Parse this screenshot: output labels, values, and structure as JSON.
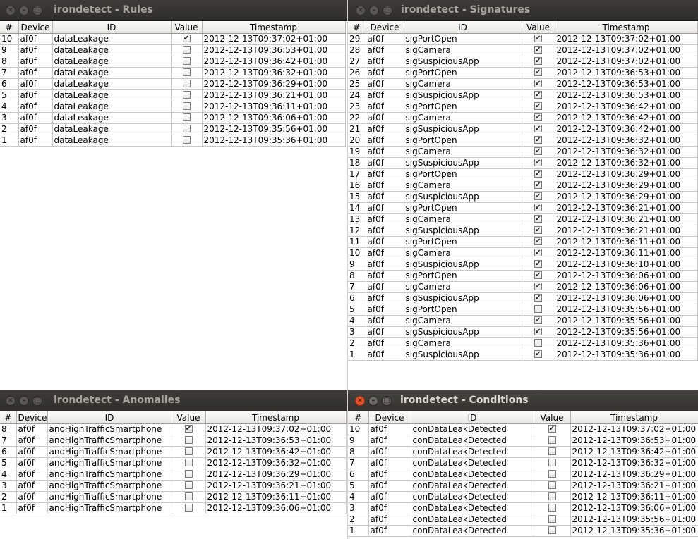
{
  "icons": {
    "close": "close-icon",
    "minimize": "minimize-icon",
    "maximize": "maximize-icon"
  },
  "colors": {
    "active_close": "#e5532c",
    "titlebar": "#3d3c38"
  },
  "windows": {
    "rules": {
      "title": "irondetect - Rules",
      "columns": [
        "#",
        "Device",
        "ID",
        "Value",
        "Timestamp"
      ],
      "rows": [
        {
          "n": "10",
          "device": "af0f",
          "id": "dataLeakage",
          "value": true,
          "ts": "2012-12-13T09:37:02+01:00"
        },
        {
          "n": "9",
          "device": "af0f",
          "id": "dataLeakage",
          "value": false,
          "ts": "2012-12-13T09:36:53+01:00"
        },
        {
          "n": "8",
          "device": "af0f",
          "id": "dataLeakage",
          "value": false,
          "ts": "2012-12-13T09:36:42+01:00"
        },
        {
          "n": "7",
          "device": "af0f",
          "id": "dataLeakage",
          "value": false,
          "ts": "2012-12-13T09:36:32+01:00"
        },
        {
          "n": "6",
          "device": "af0f",
          "id": "dataLeakage",
          "value": false,
          "ts": "2012-12-13T09:36:29+01:00"
        },
        {
          "n": "5",
          "device": "af0f",
          "id": "dataLeakage",
          "value": false,
          "ts": "2012-12-13T09:36:21+01:00"
        },
        {
          "n": "4",
          "device": "af0f",
          "id": "dataLeakage",
          "value": false,
          "ts": "2012-12-13T09:36:11+01:00"
        },
        {
          "n": "3",
          "device": "af0f",
          "id": "dataLeakage",
          "value": false,
          "ts": "2012-12-13T09:36:06+01:00"
        },
        {
          "n": "2",
          "device": "af0f",
          "id": "dataLeakage",
          "value": false,
          "ts": "2012-12-13T09:35:56+01:00"
        },
        {
          "n": "1",
          "device": "af0f",
          "id": "dataLeakage",
          "value": false,
          "ts": "2012-12-13T09:35:36+01:00"
        }
      ]
    },
    "signatures": {
      "title": "irondetect - Signatures",
      "columns": [
        "#",
        "Device",
        "ID",
        "Value",
        "Timestamp"
      ],
      "rows": [
        {
          "n": "29",
          "device": "af0f",
          "id": "sigPortOpen",
          "value": true,
          "ts": "2012-12-13T09:37:02+01:00"
        },
        {
          "n": "28",
          "device": "af0f",
          "id": "sigCamera",
          "value": true,
          "ts": "2012-12-13T09:37:02+01:00"
        },
        {
          "n": "27",
          "device": "af0f",
          "id": "sigSuspiciousApp",
          "value": true,
          "ts": "2012-12-13T09:37:02+01:00"
        },
        {
          "n": "26",
          "device": "af0f",
          "id": "sigPortOpen",
          "value": true,
          "ts": "2012-12-13T09:36:53+01:00"
        },
        {
          "n": "25",
          "device": "af0f",
          "id": "sigCamera",
          "value": true,
          "ts": "2012-12-13T09:36:53+01:00"
        },
        {
          "n": "24",
          "device": "af0f",
          "id": "sigSuspiciousApp",
          "value": true,
          "ts": "2012-12-13T09:36:53+01:00"
        },
        {
          "n": "23",
          "device": "af0f",
          "id": "sigPortOpen",
          "value": true,
          "ts": "2012-12-13T09:36:42+01:00"
        },
        {
          "n": "22",
          "device": "af0f",
          "id": "sigCamera",
          "value": true,
          "ts": "2012-12-13T09:36:42+01:00"
        },
        {
          "n": "21",
          "device": "af0f",
          "id": "sigSuspiciousApp",
          "value": true,
          "ts": "2012-12-13T09:36:42+01:00"
        },
        {
          "n": "20",
          "device": "af0f",
          "id": "sigPortOpen",
          "value": true,
          "ts": "2012-12-13T09:36:32+01:00"
        },
        {
          "n": "19",
          "device": "af0f",
          "id": "sigCamera",
          "value": true,
          "ts": "2012-12-13T09:36:32+01:00"
        },
        {
          "n": "18",
          "device": "af0f",
          "id": "sigSuspiciousApp",
          "value": true,
          "ts": "2012-12-13T09:36:32+01:00"
        },
        {
          "n": "17",
          "device": "af0f",
          "id": "sigPortOpen",
          "value": true,
          "ts": "2012-12-13T09:36:29+01:00"
        },
        {
          "n": "16",
          "device": "af0f",
          "id": "sigCamera",
          "value": true,
          "ts": "2012-12-13T09:36:29+01:00"
        },
        {
          "n": "15",
          "device": "af0f",
          "id": "sigSuspiciousApp",
          "value": true,
          "ts": "2012-12-13T09:36:29+01:00"
        },
        {
          "n": "14",
          "device": "af0f",
          "id": "sigPortOpen",
          "value": true,
          "ts": "2012-12-13T09:36:21+01:00"
        },
        {
          "n": "13",
          "device": "af0f",
          "id": "sigCamera",
          "value": true,
          "ts": "2012-12-13T09:36:21+01:00"
        },
        {
          "n": "12",
          "device": "af0f",
          "id": "sigSuspiciousApp",
          "value": true,
          "ts": "2012-12-13T09:36:21+01:00"
        },
        {
          "n": "11",
          "device": "af0f",
          "id": "sigPortOpen",
          "value": true,
          "ts": "2012-12-13T09:36:11+01:00"
        },
        {
          "n": "10",
          "device": "af0f",
          "id": "sigCamera",
          "value": true,
          "ts": "2012-12-13T09:36:11+01:00"
        },
        {
          "n": "9",
          "device": "af0f",
          "id": "sigSuspiciousApp",
          "value": true,
          "ts": "2012-12-13T09:36:10+01:00"
        },
        {
          "n": "8",
          "device": "af0f",
          "id": "sigPortOpen",
          "value": true,
          "ts": "2012-12-13T09:36:06+01:00"
        },
        {
          "n": "7",
          "device": "af0f",
          "id": "sigCamera",
          "value": true,
          "ts": "2012-12-13T09:36:06+01:00"
        },
        {
          "n": "6",
          "device": "af0f",
          "id": "sigSuspiciousApp",
          "value": true,
          "ts": "2012-12-13T09:36:06+01:00"
        },
        {
          "n": "5",
          "device": "af0f",
          "id": "sigPortOpen",
          "value": false,
          "ts": "2012-12-13T09:35:56+01:00"
        },
        {
          "n": "4",
          "device": "af0f",
          "id": "sigCamera",
          "value": true,
          "ts": "2012-12-13T09:35:56+01:00"
        },
        {
          "n": "3",
          "device": "af0f",
          "id": "sigSuspiciousApp",
          "value": true,
          "ts": "2012-12-13T09:35:56+01:00"
        },
        {
          "n": "2",
          "device": "af0f",
          "id": "sigCamera",
          "value": false,
          "ts": "2012-12-13T09:35:36+01:00"
        },
        {
          "n": "1",
          "device": "af0f",
          "id": "sigSuspiciousApp",
          "value": true,
          "ts": "2012-12-13T09:35:36+01:00"
        }
      ]
    },
    "anomalies": {
      "title": "irondetect - Anomalies",
      "columns": [
        "#",
        "Device",
        "ID",
        "Value",
        "Timestamp"
      ],
      "rows": [
        {
          "n": "8",
          "device": "af0f",
          "id": "anoHighTrafficSmartphone",
          "value": true,
          "ts": "2012-12-13T09:37:02+01:00"
        },
        {
          "n": "7",
          "device": "af0f",
          "id": "anoHighTrafficSmartphone",
          "value": false,
          "ts": "2012-12-13T09:36:53+01:00"
        },
        {
          "n": "6",
          "device": "af0f",
          "id": "anoHighTrafficSmartphone",
          "value": false,
          "ts": "2012-12-13T09:36:42+01:00"
        },
        {
          "n": "5",
          "device": "af0f",
          "id": "anoHighTrafficSmartphone",
          "value": false,
          "ts": "2012-12-13T09:36:32+01:00"
        },
        {
          "n": "4",
          "device": "af0f",
          "id": "anoHighTrafficSmartphone",
          "value": false,
          "ts": "2012-12-13T09:36:29+01:00"
        },
        {
          "n": "3",
          "device": "af0f",
          "id": "anoHighTrafficSmartphone",
          "value": false,
          "ts": "2012-12-13T09:36:21+01:00"
        },
        {
          "n": "2",
          "device": "af0f",
          "id": "anoHighTrafficSmartphone",
          "value": false,
          "ts": "2012-12-13T09:36:11+01:00"
        },
        {
          "n": "1",
          "device": "af0f",
          "id": "anoHighTrafficSmartphone",
          "value": false,
          "ts": "2012-12-13T09:36:06+01:00"
        }
      ]
    },
    "conditions": {
      "title": "irondetect - Conditions",
      "columns": [
        "#",
        "Device",
        "ID",
        "Value",
        "Timestamp"
      ],
      "rows": [
        {
          "n": "10",
          "device": "af0f",
          "id": "conDataLeakDetected",
          "value": true,
          "ts": "2012-12-13T09:37:02+01:00"
        },
        {
          "n": "9",
          "device": "af0f",
          "id": "conDataLeakDetected",
          "value": false,
          "ts": "2012-12-13T09:36:53+01:00"
        },
        {
          "n": "8",
          "device": "af0f",
          "id": "conDataLeakDetected",
          "value": false,
          "ts": "2012-12-13T09:36:42+01:00"
        },
        {
          "n": "7",
          "device": "af0f",
          "id": "conDataLeakDetected",
          "value": false,
          "ts": "2012-12-13T09:36:32+01:00"
        },
        {
          "n": "6",
          "device": "af0f",
          "id": "conDataLeakDetected",
          "value": false,
          "ts": "2012-12-13T09:36:29+01:00"
        },
        {
          "n": "5",
          "device": "af0f",
          "id": "conDataLeakDetected",
          "value": false,
          "ts": "2012-12-13T09:36:21+01:00"
        },
        {
          "n": "4",
          "device": "af0f",
          "id": "conDataLeakDetected",
          "value": false,
          "ts": "2012-12-13T09:36:11+01:00"
        },
        {
          "n": "3",
          "device": "af0f",
          "id": "conDataLeakDetected",
          "value": false,
          "ts": "2012-12-13T09:36:06+01:00"
        },
        {
          "n": "2",
          "device": "af0f",
          "id": "conDataLeakDetected",
          "value": false,
          "ts": "2012-12-13T09:35:56+01:00"
        },
        {
          "n": "1",
          "device": "af0f",
          "id": "conDataLeakDetected",
          "value": false,
          "ts": "2012-12-13T09:35:36+01:00"
        }
      ]
    }
  }
}
